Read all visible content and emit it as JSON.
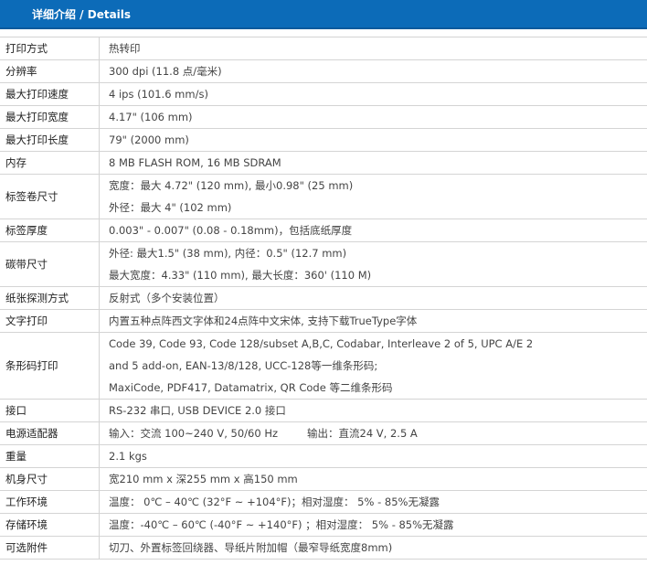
{
  "header": {
    "title": "详细介绍 / Details"
  },
  "specs": [
    {
      "label": "打印方式",
      "lines": [
        "热转印"
      ]
    },
    {
      "label": "分辨率",
      "lines": [
        "300 dpi (11.8 点/毫米)"
      ]
    },
    {
      "label": "最大打印速度",
      "lines": [
        "4 ips (101.6 mm/s)"
      ]
    },
    {
      "label": "最大打印宽度",
      "lines": [
        "4.17\" (106 mm)"
      ]
    },
    {
      "label": "最大打印长度",
      "lines": [
        "79\" (2000 mm)"
      ]
    },
    {
      "label": "内存",
      "lines": [
        "8 MB FLASH ROM, 16 MB SDRAM"
      ]
    },
    {
      "label": "标签卷尺寸",
      "lines": [
        "宽度：最大 4.72\" (120 mm), 最小0.98\" (25 mm)",
        "外径：最大 4\" (102 mm)"
      ]
    },
    {
      "label": "标签厚度",
      "lines": [
        "0.003\" - 0.007\" (0.08 - 0.18mm)，包括底纸厚度"
      ]
    },
    {
      "label": "碳带尺寸",
      "lines": [
        "外径: 最大1.5\" (38 mm), 内径：0.5\" (12.7 mm)",
        "最大宽度：4.33\" (110 mm), 最大长度：360' (110 M)"
      ]
    },
    {
      "label": "纸张探测方式",
      "lines": [
        "反射式（多个安装位置）"
      ]
    },
    {
      "label": "文字打印",
      "lines": [
        "内置五种点阵西文字体和24点阵中文宋体, 支持下载TrueType字体"
      ]
    },
    {
      "label": "条形码打印",
      "lines": [
        "Code 39, Code 93, Code 128/subset A,B,C, Codabar, Interleave 2 of 5, UPC A/E 2",
        "and 5 add-on, EAN-13/8/128, UCC-128等一维条形码;",
        "MaxiCode, PDF417, Datamatrix, QR Code 等二维条形码"
      ]
    },
    {
      "label": "接口",
      "lines": [
        "RS-232 串口, USB DEVICE 2.0 接口"
      ]
    },
    {
      "label": "电源适配器",
      "input": "输入：交流 100~240 V, 50/60 Hz",
      "output": "输出：直流24 V, 2.5 A"
    },
    {
      "label": "重量",
      "lines": [
        "2.1 kgs"
      ]
    },
    {
      "label": "机身尺寸",
      "lines": [
        "宽210 mm x 深255 mm x 高150 mm"
      ]
    },
    {
      "label": "工作环境",
      "lines": [
        "温度： 0℃ – 40℃ (32°F ~ +104°F)；相对湿度： 5% - 85%无凝露"
      ]
    },
    {
      "label": "存储环境",
      "lines": [
        "温度：-40℃ – 60℃ (-40°F ~ +140°F) ；相对湿度： 5% - 85%无凝露"
      ]
    },
    {
      "label": "可选附件",
      "lines": [
        "切刀、外置标签回绕器、导纸片附加帽（最窄导纸宽度8mm)"
      ]
    }
  ]
}
